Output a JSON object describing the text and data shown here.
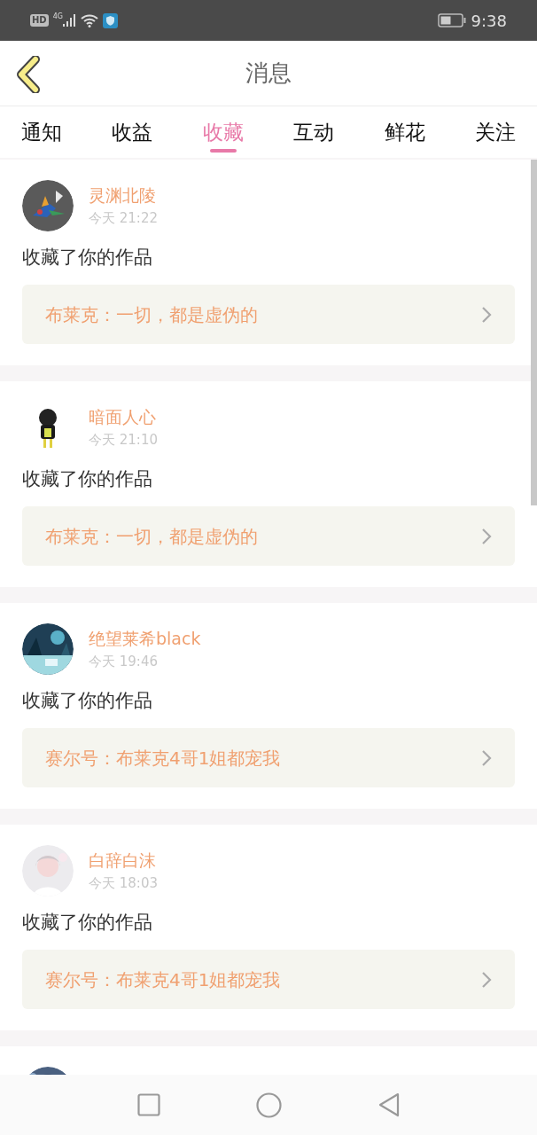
{
  "status_bar": {
    "hd": "HD",
    "network": "4G",
    "time": "9:38"
  },
  "header": {
    "title": "消息"
  },
  "tabs": [
    {
      "label": "通知",
      "selected": false
    },
    {
      "label": "收益",
      "selected": false
    },
    {
      "label": "收藏",
      "selected": true
    },
    {
      "label": "互动",
      "selected": false
    },
    {
      "label": "鲜花",
      "selected": false
    },
    {
      "label": "关注",
      "selected": false
    }
  ],
  "messages": [
    {
      "name": "灵渊北陵",
      "time": "今天 21:22",
      "text": "收藏了你的作品",
      "work": "布莱克：一切，都是虚伪的"
    },
    {
      "name": "暗面人心",
      "time": "今天 21:10",
      "text": "收藏了你的作品",
      "work": "布莱克：一切，都是虚伪的"
    },
    {
      "name": "绝望莱希black",
      "time": "今天 19:46",
      "text": "收藏了你的作品",
      "work": "赛尔号：布莱克4哥1姐都宠我"
    },
    {
      "name": "白辞白沫",
      "time": "今天 18:03",
      "text": "收藏了你的作品",
      "work": "赛尔号：布莱克4哥1姐都宠我"
    }
  ]
}
